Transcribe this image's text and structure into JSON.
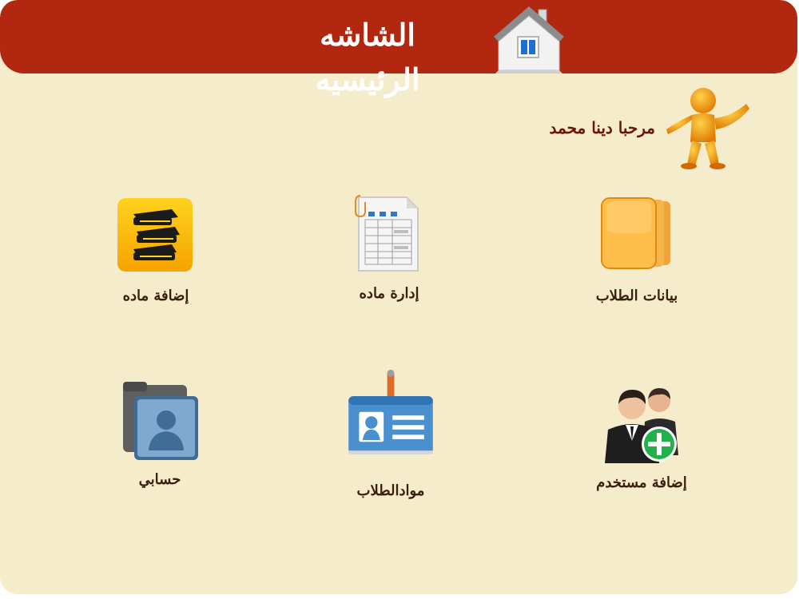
{
  "header": {
    "title": "الشاشه الرئيسيه",
    "icon": "home-icon"
  },
  "welcome": {
    "text": "مرحبا دينا محمد",
    "icon": "person-welcome-icon"
  },
  "tiles": [
    {
      "label": "إضافة ماده",
      "icon": "books-icon"
    },
    {
      "label": "إدارة  ماده",
      "icon": "spreadsheet-icon"
    },
    {
      "label": "بيانات الطلاب",
      "icon": "folders-icon"
    },
    {
      "label": "حسابي",
      "icon": "profile-folder-icon"
    },
    {
      "label": "موادالطلاب",
      "icon": "id-card-icon"
    },
    {
      "label": "إضافة مستخدم",
      "icon": "add-user-icon"
    }
  ],
  "colors": {
    "header": "#b2270f",
    "background": "#f4ecca",
    "label_text": "#3a1e10",
    "welcome_text": "#6a1505"
  }
}
